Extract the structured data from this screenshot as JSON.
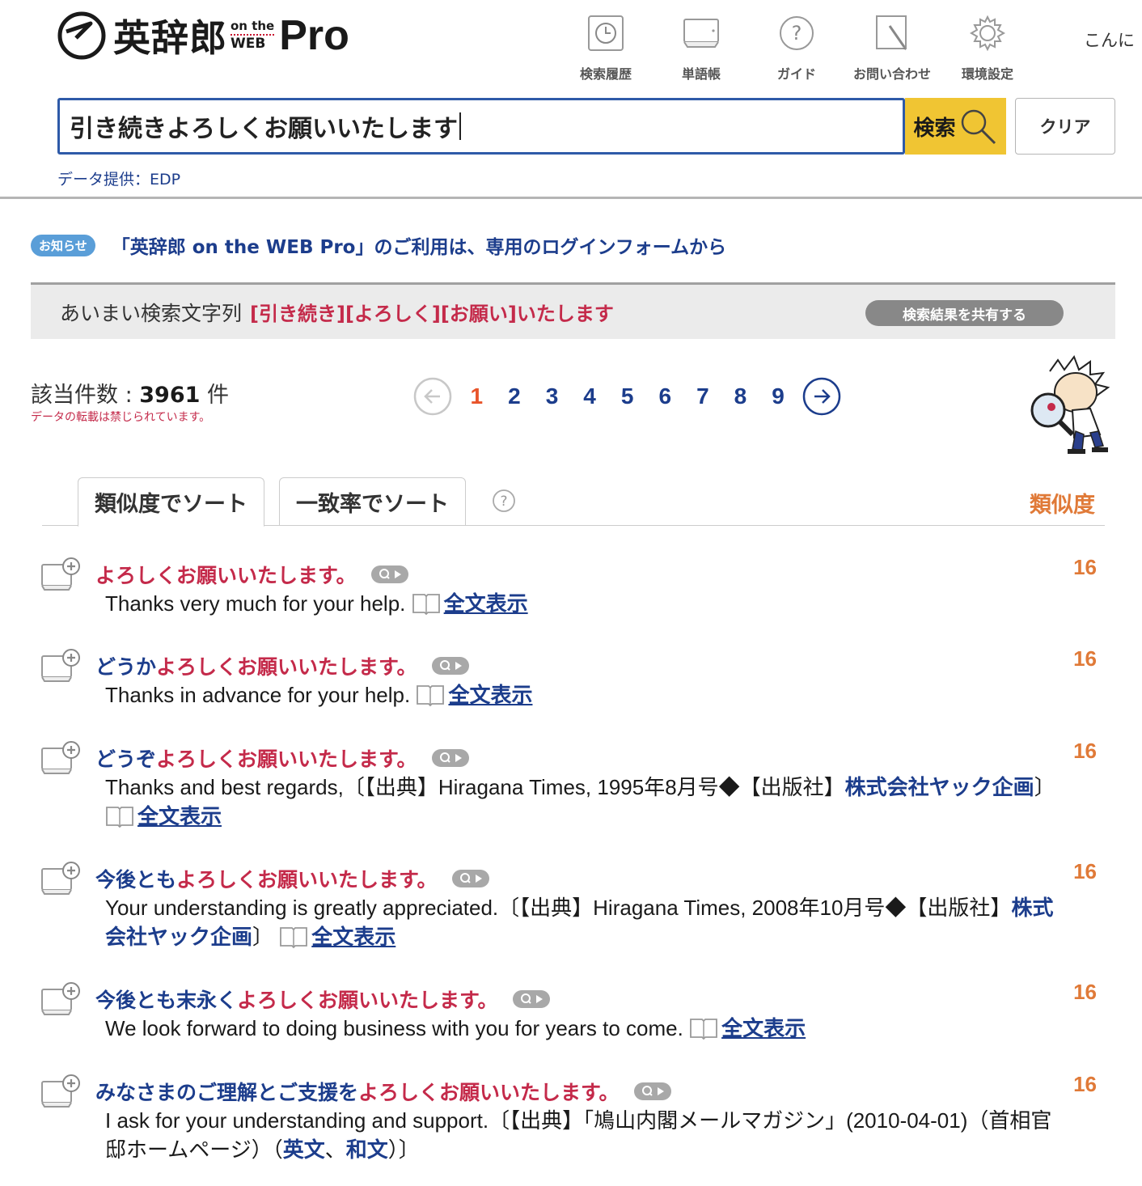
{
  "app": {
    "logo_jp": "英辞郎",
    "logo_sub1": "on the",
    "logo_sub2": "WEB",
    "logo_pro": "Pro"
  },
  "toolbar": {
    "history": "検索履歴",
    "wordbook": "単語帳",
    "guide": "ガイド",
    "contact": "お問い合わせ",
    "settings": "環境設定"
  },
  "greeting": "こんに",
  "search": {
    "value": "引き続きよろしくお願いいたします",
    "button_label": "検索",
    "clear_label": "クリア"
  },
  "data_provider": "データ提供：EDP",
  "notice": {
    "badge": "お知らせ",
    "text": "「英辞郎 on the WEB Pro」のご利用は、専用のログインフォームから"
  },
  "fuzzy": {
    "label": "あいまい検索文字列",
    "terms": "[引き続き][よろしく][お願い]いたします",
    "share_label": "検索結果を共有する"
  },
  "results_count": {
    "label": "該当件数 : ",
    "value": "3961",
    "unit": " 件",
    "warning": "データの転載は禁じられています。"
  },
  "pagination": {
    "pages": [
      "1",
      "2",
      "3",
      "4",
      "5",
      "6",
      "7",
      "8",
      "9"
    ],
    "current": "1"
  },
  "tabs": {
    "similarity": "類似度でソート",
    "match_rate": "一致率でソート",
    "sort_label": "類似度"
  },
  "fulltext_label": "全文表示",
  "results": [
    {
      "pre": "",
      "match": "よろしくお願いいたします。",
      "score": "16",
      "translation": "Thanks very much for your help.",
      "suffix": ""
    },
    {
      "pre": "どうか",
      "match": "よろしくお願いいたします。",
      "score": "16",
      "translation": "Thanks in advance for your help.",
      "suffix": ""
    },
    {
      "pre": "どうぞ",
      "match": "よろしくお願いいたします。",
      "score": "16",
      "translation": "Thanks and best regards,〔【出典】Hiragana Times, 1995年8月号◆【出版社】",
      "link": "株式会社ヤック企画",
      "suffix": "〕"
    },
    {
      "pre": "今後とも",
      "match": "よろしくお願いいたします。",
      "score": "16",
      "translation": "Your understanding is greatly appreciated.〔【出典】Hiragana Times, 2008年10月号◆【出版社】",
      "link": "株式会社ヤック企画",
      "suffix": "〕"
    },
    {
      "pre": "今後とも末永く",
      "match": "よろしくお願いいたします。",
      "score": "16",
      "translation": "We look forward to doing business with you for years to come.",
      "suffix": ""
    },
    {
      "pre": "みなさまのご理解とご支援を",
      "match": "よろしくお願いいたします。",
      "score": "16",
      "translation": "I ask for your understanding and support.〔【出典】「鳩山内閣メールマガジン」(2010-04-01)（首相官邸ホームページ）（",
      "link": "英文",
      "sep": "、",
      "link2": "和文",
      "suffix": "）〕"
    }
  ]
}
